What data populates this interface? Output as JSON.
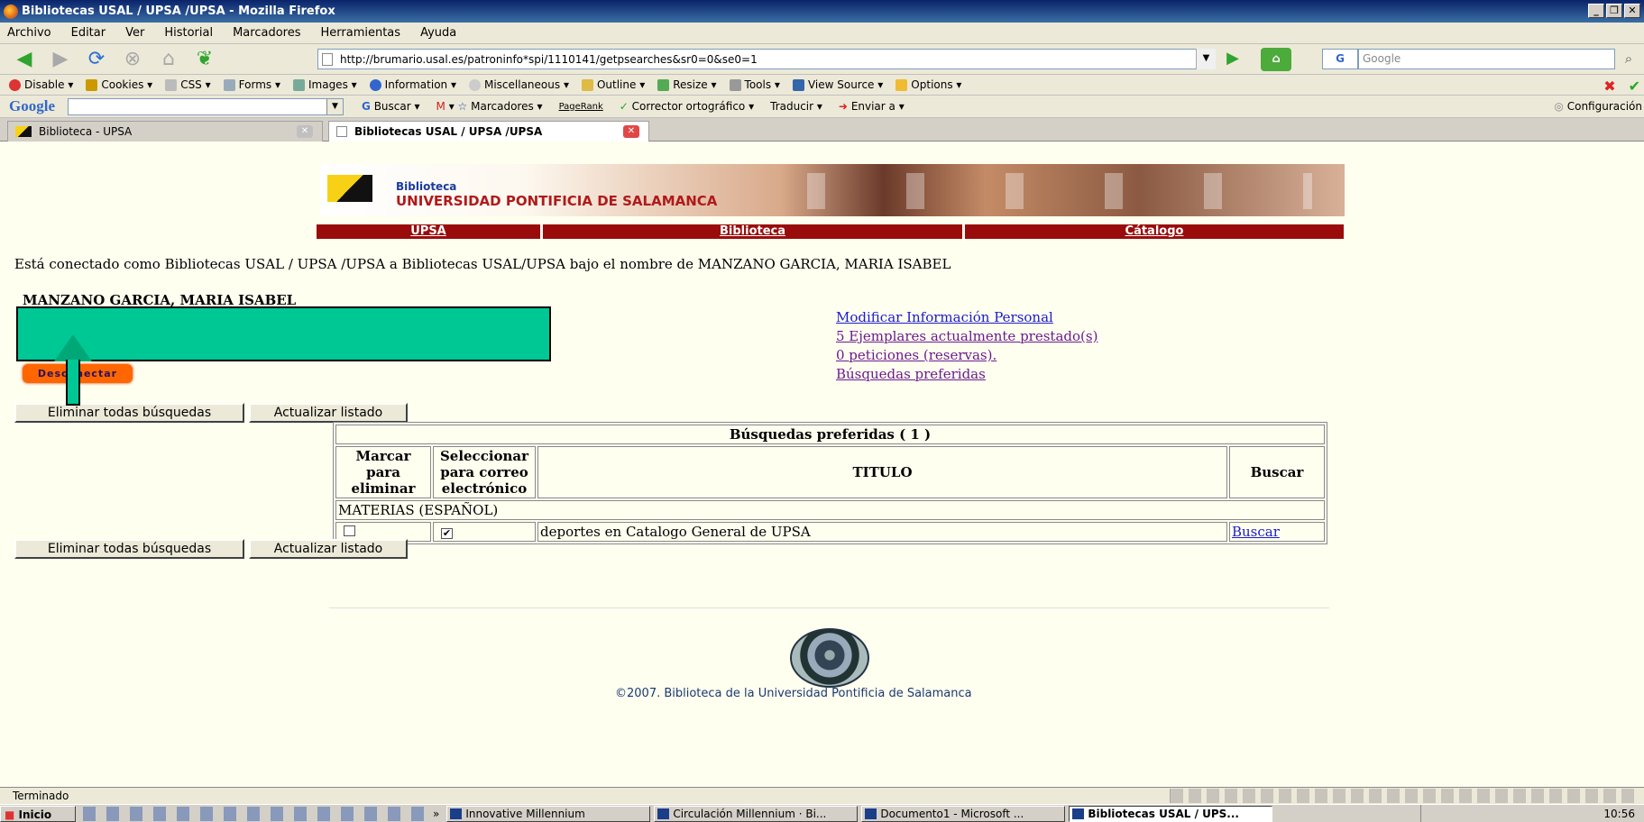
{
  "window": {
    "title": "Bibliotecas USAL / UPSA /UPSA - Mozilla Firefox",
    "controls": [
      "_",
      "&#x2750;",
      "✕"
    ]
  },
  "menu": [
    "Archivo",
    "Editar",
    "Ver",
    "Historial",
    "Marcadores",
    "Herramientas",
    "Ayuda"
  ],
  "nav": {
    "url": "http://brumario.usal.es/patroninfo*spi/1110141/getpsearches&sr0=0&se0=1",
    "search_placeholder": "Google",
    "search_engine": "G"
  },
  "devbar": [
    "Disable",
    "Cookies",
    "CSS",
    "Forms",
    "Images",
    "Information",
    "Miscellaneous",
    "Outline",
    "Resize",
    "Tools",
    "View Source",
    "Options"
  ],
  "googlebar": {
    "logo": "Google",
    "items": [
      "Buscar",
      "Marcadores",
      "PageRank",
      "Corrector ortográfico",
      "Traducir",
      "Enviar a"
    ],
    "config": "Configuración"
  },
  "tabs": [
    {
      "label": "Biblioteca - UPSA",
      "active": false
    },
    {
      "label": "Bibliotecas USAL / UPSA /UPSA",
      "active": true
    }
  ],
  "banner": {
    "small": "Biblioteca",
    "big": "UNIVERSIDAD PONTIFICIA DE SALAMANCA"
  },
  "sitenav": [
    "UPSA",
    "Biblioteca",
    "Cátalogo"
  ],
  "connected_text": "Está conectado como Bibliotecas USAL / UPSA /UPSA a Bibliotecas USAL/UPSA bajo el nombre de MANZANO GARCIA, MARIA ISABEL",
  "patron_name": "MANZANO GARCIA, MARIA ISABEL",
  "logout_label": "Desconectar",
  "links": [
    "Modificar Información Personal",
    "5 Ejemplares actualmente prestado(s)",
    "0 peticiones (reservas).",
    "Búsquedas preferidas"
  ],
  "buttons": {
    "delete_all": "Eliminar todas búsquedas",
    "refresh": "Actualizar listado"
  },
  "table": {
    "caption": "Búsquedas preferidas ( 1 )",
    "headers": [
      "Marcar para eliminar",
      "Seleccionar para correo electrónico",
      "TITULO",
      "Buscar"
    ],
    "group": "MATERIAS (ESPAÑOL)",
    "rows": [
      {
        "mark": false,
        "email": true,
        "title": "deportes en Catalogo General de UPSA",
        "action": "Buscar"
      }
    ]
  },
  "footer": "©2007. Biblioteca de la Universidad Pontificia de Salamanca",
  "status": "Terminado",
  "taskbar": {
    "start": "Inicio",
    "more": "»",
    "windows": [
      "Innovative Millennium",
      "Circulación Millennium · Bi...",
      "Documento1 - Microsoft ...",
      "Bibliotecas USAL / UPS..."
    ],
    "time": "10:56"
  }
}
